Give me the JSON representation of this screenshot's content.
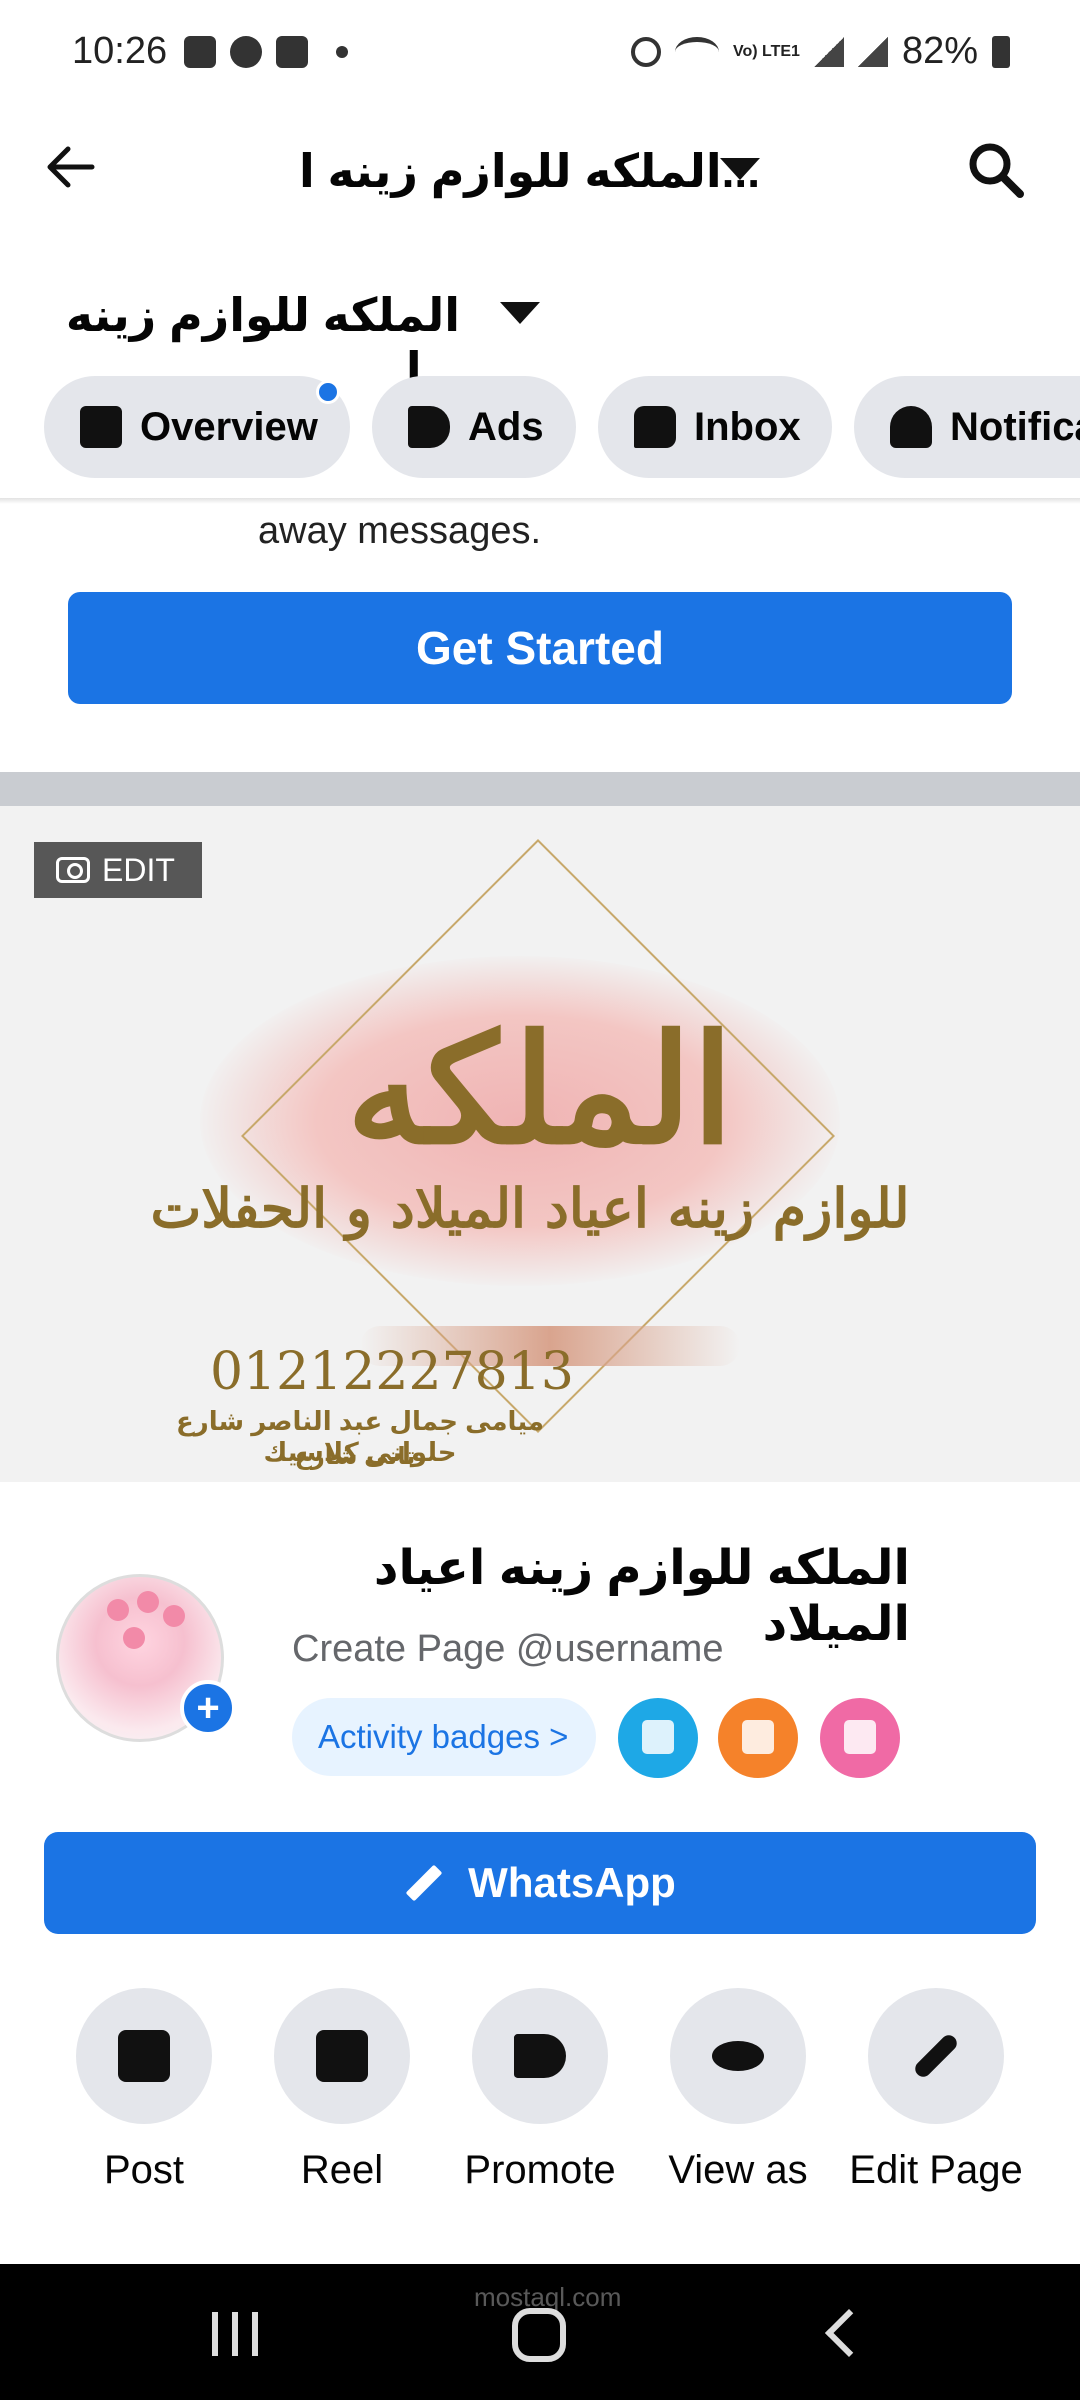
{
  "status_bar": {
    "time": "10:26",
    "battery": "82%",
    "network": "Vo) LTE1"
  },
  "header": {
    "title": "الملكه للوازم زينه ا..."
  },
  "page_switcher": {
    "title": "الملكه للوازم زينه ا..."
  },
  "tabs": [
    {
      "label": "Overview",
      "icon": "list-icon"
    },
    {
      "label": "Ads",
      "icon": "megaphone-icon"
    },
    {
      "label": "Inbox",
      "icon": "chat-icon"
    },
    {
      "label": "Notifica",
      "icon": "bell-icon"
    }
  ],
  "promo": {
    "text": "away messages.",
    "button": "Get Started"
  },
  "cover": {
    "edit_label": "EDIT",
    "title": "الملكه",
    "subtitle": "للوازم زينه اعياد الميلاد و الحفلات",
    "phone": "01212227813",
    "address_line1": "ميامى جمال عبد الناصر شارع حلوانى كلاسيك",
    "address_line2": "تانى شارع يمين"
  },
  "profile": {
    "name": "الملكه للوازم زينه اعياد الميلاد",
    "username_prompt": "Create Page @username",
    "badges_label": "Activity badges >",
    "badges": [
      {
        "icon": "thumbs-up-badge-icon",
        "color": "#1ea8e6"
      },
      {
        "icon": "pencil-badge-icon",
        "color": "#f5822a"
      },
      {
        "icon": "clipboard-badge-icon",
        "color": "#f06aa5"
      }
    ]
  },
  "cta": {
    "label": "WhatsApp"
  },
  "actions": [
    {
      "label": "Post",
      "icon": "compose-icon"
    },
    {
      "label": "Reel",
      "icon": "reel-icon"
    },
    {
      "label": "Promote",
      "icon": "megaphone-icon"
    },
    {
      "label": "View as",
      "icon": "eye-icon"
    },
    {
      "label": "Edit Page",
      "icon": "pencil-icon"
    }
  ],
  "watermark": "mostaql.com",
  "colors": {
    "primary": "#1b74e4",
    "tab_bg": "#e4e6eb",
    "divider": "#c9ccd1",
    "gold": "#8a6d2a"
  }
}
